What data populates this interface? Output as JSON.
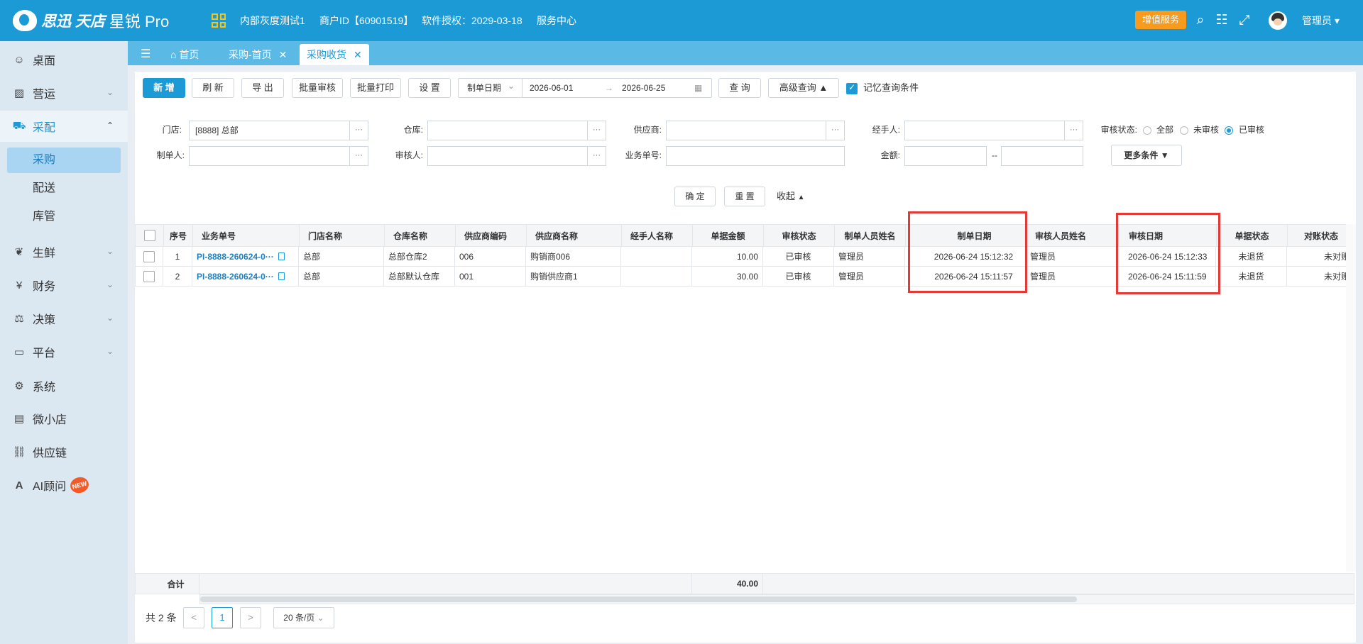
{
  "header": {
    "brand": "思迅 天店",
    "product": "星锐 Pro",
    "tenant": "内部灰度测试1",
    "merchant_id": "商户ID【60901519】",
    "license": "软件授权：2029-03-18",
    "service_center": "服务中心",
    "vas_button": "增值服务",
    "user": "管理员"
  },
  "sidebar": {
    "items": [
      {
        "label": "桌面",
        "icon": "user-circle-icon"
      },
      {
        "label": "营运",
        "icon": "chart-icon"
      },
      {
        "label": "采配",
        "icon": "cart-icon"
      },
      {
        "label": "生鲜",
        "icon": "fruit-icon"
      },
      {
        "label": "财务",
        "icon": "yen-icon"
      },
      {
        "label": "决策",
        "icon": "decision-icon"
      },
      {
        "label": "平台",
        "icon": "monitor-icon"
      },
      {
        "label": "系统",
        "icon": "gear-icon"
      },
      {
        "label": "微小店",
        "icon": "store-icon"
      },
      {
        "label": "供应链",
        "icon": "link-icon"
      },
      {
        "label": "AI顾问",
        "icon": "ai-icon"
      }
    ],
    "sub_items": [
      "采购",
      "配送",
      "库管"
    ],
    "new_badge": "NEW"
  },
  "tabs": {
    "home": "首页",
    "purchase_home": "采购-首页",
    "current": "采购收货",
    "close": "✕"
  },
  "toolbar": {
    "add": "新 增",
    "refresh": "刷 新",
    "export": "导 出",
    "batch_audit": "批量审核",
    "batch_print": "批量打印",
    "settings": "设 置",
    "date_type": "制单日期",
    "date_from": "2026-06-01",
    "date_sep": "→",
    "date_to": "2026-06-25",
    "query": "查 询",
    "advanced": "高级查询",
    "remember": "记忆查询条件"
  },
  "filters": {
    "store_label": "门店:",
    "store_value": "[8888] 总部",
    "warehouse_label": "仓库:",
    "supplier_label": "供应商:",
    "handler_label": "经手人:",
    "audit_status_label": "审核状态:",
    "audit_options": [
      "全部",
      "未审核",
      "已审核"
    ],
    "creator_label": "制单人:",
    "auditor_label": "审核人:",
    "order_no_label": "业务单号:",
    "amount_label": "金额:",
    "amount_sep": "--",
    "more": "更多条件",
    "ellipsis": "···",
    "confirm": "确 定",
    "reset": "重 置",
    "collapse": "收起"
  },
  "table": {
    "columns": [
      "序号",
      "业务单号",
      "门店名称",
      "仓库名称",
      "供应商编码",
      "供应商名称",
      "经手人名称",
      "单据金额",
      "审核状态",
      "制单人员姓名",
      "制单日期",
      "审核人员姓名",
      "审核日期",
      "单据状态",
      "对账状态"
    ],
    "rows": [
      {
        "no": "1",
        "order": "PI-8888-260624-0···",
        "store": "总部",
        "warehouse": "总部仓库2",
        "supplier_code": "006",
        "supplier_name": "购销商006",
        "handler": "",
        "amount": "10.00",
        "audit_status": "已审核",
        "creator": "管理员",
        "created_at": "2026-06-24 15:12:32",
        "auditor": "管理员",
        "audited_at": "2026-06-24 15:12:33",
        "doc_status": "未退货",
        "reconcile": "未对账"
      },
      {
        "no": "2",
        "order": "PI-8888-260624-0···",
        "store": "总部",
        "warehouse": "总部默认仓库",
        "supplier_code": "001",
        "supplier_name": "购销供应商1",
        "handler": "",
        "amount": "30.00",
        "audit_status": "已审核",
        "creator": "管理员",
        "created_at": "2026-06-24 15:11:57",
        "auditor": "管理员",
        "audited_at": "2026-06-24 15:11:59",
        "doc_status": "未退货",
        "reconcile": "未对账"
      }
    ],
    "total_label": "合计",
    "total_amount": "40.00"
  },
  "pager": {
    "total": "共 2 条",
    "prev": "<",
    "page": "1",
    "next": ">",
    "page_size": "20 条/页"
  },
  "colors": {
    "primary": "#1b9ad6",
    "accent": "#f89a1c",
    "highlight": "#e53935"
  }
}
